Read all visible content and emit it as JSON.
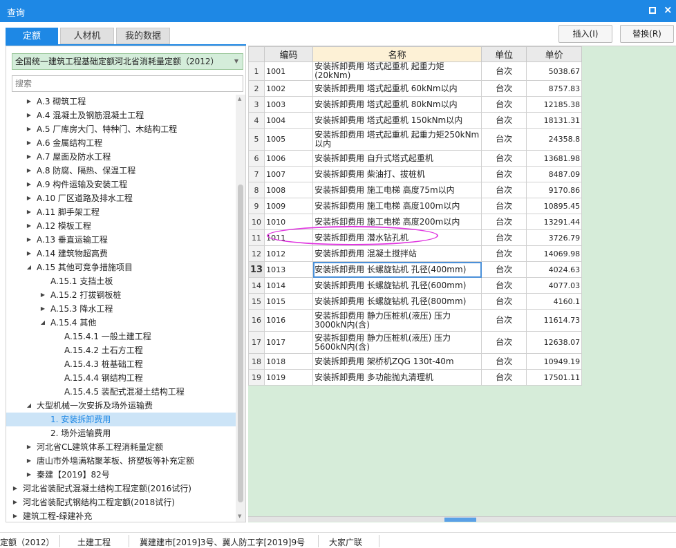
{
  "window": {
    "title": "查询"
  },
  "tabs": [
    {
      "label": "定额",
      "active": true
    },
    {
      "label": "人材机",
      "active": false
    },
    {
      "label": "我的数据",
      "active": false
    }
  ],
  "actions": {
    "insert": "插入(I)",
    "replace": "替换(R)"
  },
  "library": {
    "selected": "全国统一建筑工程基础定额河北省消耗量定额（2012）"
  },
  "search": {
    "placeholder": "搜索"
  },
  "tree": [
    {
      "label": "A.3 砌筑工程",
      "level": 2,
      "toggle": "collapsed"
    },
    {
      "label": "A.4 混凝土及钢筋混凝土工程",
      "level": 2,
      "toggle": "collapsed"
    },
    {
      "label": "A.5 厂库房大门、特种门、木结构工程",
      "level": 2,
      "toggle": "collapsed"
    },
    {
      "label": "A.6 金属结构工程",
      "level": 2,
      "toggle": "collapsed"
    },
    {
      "label": "A.7 屋面及防水工程",
      "level": 2,
      "toggle": "collapsed"
    },
    {
      "label": "A.8 防腐、隔热、保温工程",
      "level": 2,
      "toggle": "collapsed"
    },
    {
      "label": "A.9 构件运输及安装工程",
      "level": 2,
      "toggle": "collapsed"
    },
    {
      "label": "A.10 厂区道路及排水工程",
      "level": 2,
      "toggle": "collapsed"
    },
    {
      "label": "A.11 脚手架工程",
      "level": 2,
      "toggle": "collapsed"
    },
    {
      "label": "A.12 模板工程",
      "level": 2,
      "toggle": "collapsed"
    },
    {
      "label": "A.13 垂直运输工程",
      "level": 2,
      "toggle": "collapsed"
    },
    {
      "label": "A.14 建筑物超高费",
      "level": 2,
      "toggle": "collapsed"
    },
    {
      "label": "A.15 其他可竞争措施项目",
      "level": 2,
      "toggle": "expanded"
    },
    {
      "label": "A.15.1 支挡土板",
      "level": 3,
      "toggle": "none"
    },
    {
      "label": "A.15.2 打拔钢板桩",
      "level": 3,
      "toggle": "collapsed"
    },
    {
      "label": "A.15.3 降水工程",
      "level": 3,
      "toggle": "collapsed"
    },
    {
      "label": "A.15.4 其他",
      "level": 3,
      "toggle": "expanded"
    },
    {
      "label": "A.15.4.1 一般土建工程",
      "level": 4,
      "toggle": "none"
    },
    {
      "label": "A.15.4.2 土石方工程",
      "level": 4,
      "toggle": "none"
    },
    {
      "label": "A.15.4.3 桩基础工程",
      "level": 4,
      "toggle": "none"
    },
    {
      "label": "A.15.4.4 钢结构工程",
      "level": 4,
      "toggle": "none"
    },
    {
      "label": "A.15.4.5 装配式混凝土结构工程",
      "level": 4,
      "toggle": "none"
    },
    {
      "label": "大型机械一次安拆及场外运输费",
      "level": 2,
      "toggle": "expanded"
    },
    {
      "label": "1. 安装拆卸费用",
      "level": 3,
      "toggle": "none",
      "selected": true
    },
    {
      "label": "2. 场外运输费用",
      "level": 3,
      "toggle": "none"
    },
    {
      "label": "河北省CL建筑体系工程消耗量定额",
      "level": 2,
      "toggle": "collapsed"
    },
    {
      "label": "唐山市外墙满粘聚苯板、挤塑板等补充定额",
      "level": 2,
      "toggle": "collapsed"
    },
    {
      "label": "秦建【2019】82号",
      "level": 2,
      "toggle": "collapsed"
    },
    {
      "label": "河北省装配式混凝土结构工程定额(2016试行)",
      "level": 1,
      "toggle": "collapsed"
    },
    {
      "label": "河北省装配式钢结构工程定额(2018试行)",
      "level": 1,
      "toggle": "collapsed"
    },
    {
      "label": "建筑工程-绿建补充",
      "level": 1,
      "toggle": "collapsed"
    }
  ],
  "grid": {
    "columns": [
      "编码",
      "名称",
      "单位",
      "单价"
    ],
    "current_row": 13,
    "rows": [
      {
        "n": "1",
        "code": "1001",
        "name": "安装拆卸费用 塔式起重机 起重力矩(20kNm)",
        "unit": "台次",
        "price": "5038.67"
      },
      {
        "n": "2",
        "code": "1002",
        "name": "安装拆卸费用 塔式起重机 60kNm以内",
        "unit": "台次",
        "price": "8757.83"
      },
      {
        "n": "3",
        "code": "1003",
        "name": "安装拆卸费用 塔式起重机 80kNm以内",
        "unit": "台次",
        "price": "12185.38"
      },
      {
        "n": "4",
        "code": "1004",
        "name": "安装拆卸费用 塔式起重机 150kNm以内",
        "unit": "台次",
        "price": "18131.31"
      },
      {
        "n": "5",
        "code": "1005",
        "name": "安装拆卸费用 塔式起重机 起重力矩250kNm以内",
        "unit": "台次",
        "price": "24358.8"
      },
      {
        "n": "6",
        "code": "1006",
        "name": "安装拆卸费用 自升式塔式起重机",
        "unit": "台次",
        "price": "13681.98"
      },
      {
        "n": "7",
        "code": "1007",
        "name": "安装拆卸费用 柴油打、拔桩机",
        "unit": "台次",
        "price": "8487.09"
      },
      {
        "n": "8",
        "code": "1008",
        "name": "安装拆卸费用 施工电梯 高度75m以内",
        "unit": "台次",
        "price": "9170.86"
      },
      {
        "n": "9",
        "code": "1009",
        "name": "安装拆卸费用 施工电梯 高度100m以内",
        "unit": "台次",
        "price": "10895.45"
      },
      {
        "n": "10",
        "code": "1010",
        "name": "安装拆卸费用 施工电梯 高度200m以内",
        "unit": "台次",
        "price": "13291.44"
      },
      {
        "n": "11",
        "code": "1011",
        "name": "安装拆卸费用 潜水钻孔机",
        "unit": "台次",
        "price": "3726.79"
      },
      {
        "n": "12",
        "code": "1012",
        "name": "安装拆卸费用 混凝土搅拌站",
        "unit": "台次",
        "price": "14069.98"
      },
      {
        "n": "13",
        "code": "1013",
        "name": "安装拆卸费用 长螺旋钻机 孔径(400mm)",
        "unit": "台次",
        "price": "4024.63"
      },
      {
        "n": "14",
        "code": "1014",
        "name": "安装拆卸费用 长螺旋钻机 孔径(600mm)",
        "unit": "台次",
        "price": "4077.03"
      },
      {
        "n": "15",
        "code": "1015",
        "name": "安装拆卸费用 长螺旋钻机 孔径(800mm)",
        "unit": "台次",
        "price": "4160.1"
      },
      {
        "n": "16",
        "code": "1016",
        "name": "安装拆卸费用 静力压桩机(液压) 压力3000kN内(含)",
        "unit": "台次",
        "price": "11614.73"
      },
      {
        "n": "17",
        "code": "1017",
        "name": "安装拆卸费用 静力压桩机(液压) 压力5600kN内(含)",
        "unit": "台次",
        "price": "12638.07"
      },
      {
        "n": "18",
        "code": "1018",
        "name": "安装拆卸费用 架桥机ZQG 130t-40m",
        "unit": "台次",
        "price": "10949.19"
      },
      {
        "n": "19",
        "code": "1019",
        "name": "安装拆卸费用 多功能抛丸清理机",
        "unit": "台次",
        "price": "17501.11"
      }
    ]
  },
  "status": [
    "定额（2012）",
    "土建工程",
    "冀建建市[2019]3号、冀人防工字[2019]9号",
    "大家广联"
  ],
  "colors": {
    "accent": "#1e88e5",
    "annotation": "#e036e0",
    "empty_area": "#d6ecd9"
  }
}
